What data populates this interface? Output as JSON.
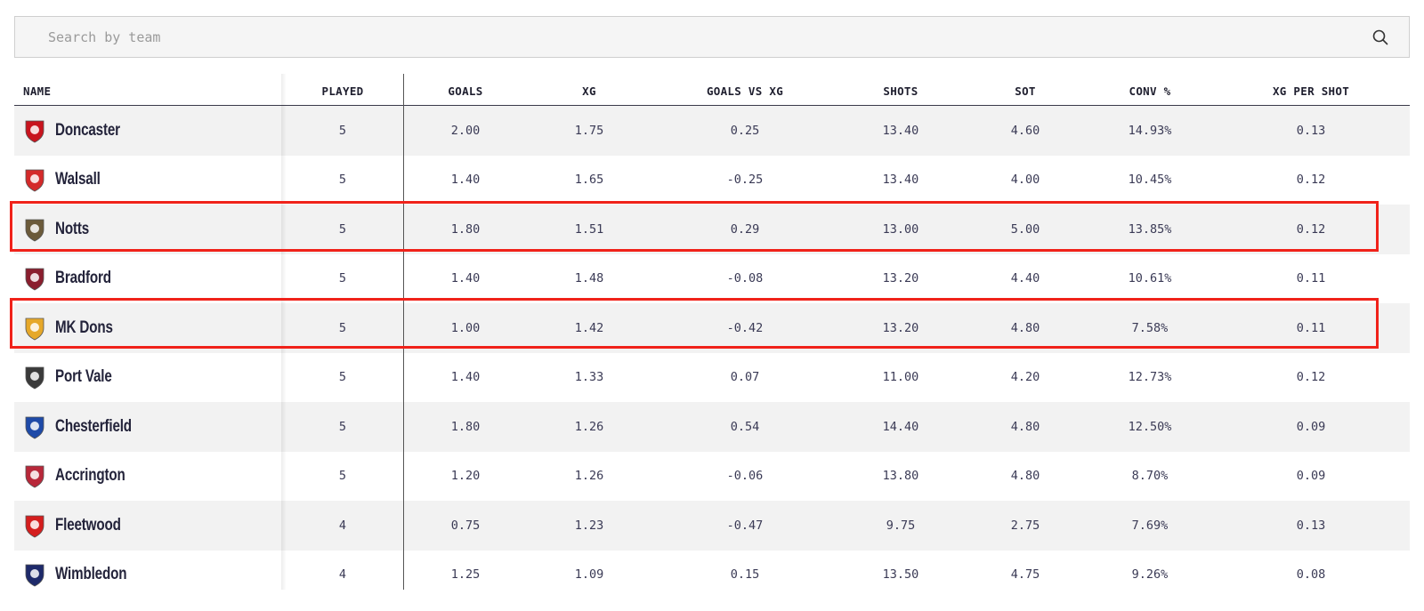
{
  "search": {
    "placeholder": "Search by team",
    "value": "",
    "icon": "search-icon"
  },
  "columns": [
    "NAME",
    "PLAYED",
    "GOALS",
    "XG",
    "GOALS VS XG",
    "SHOTS",
    "SOT",
    "CONV %",
    "XG PER SHOT"
  ],
  "rows": [
    {
      "team": "Doncaster",
      "badge_color": "#c8141e",
      "played": "5",
      "goals": "2.00",
      "xg": "1.75",
      "goals_vs_xg": "0.25",
      "shots": "13.40",
      "sot": "4.60",
      "conv": "14.93%",
      "xg_per_shot": "0.13"
    },
    {
      "team": "Walsall",
      "badge_color": "#d42a2a",
      "played": "5",
      "goals": "1.40",
      "xg": "1.65",
      "goals_vs_xg": "-0.25",
      "shots": "13.40",
      "sot": "4.00",
      "conv": "10.45%",
      "xg_per_shot": "0.12"
    },
    {
      "team": "Notts",
      "badge_color": "#6b5a3a",
      "played": "5",
      "goals": "1.80",
      "xg": "1.51",
      "goals_vs_xg": "0.29",
      "shots": "13.00",
      "sot": "5.00",
      "conv": "13.85%",
      "xg_per_shot": "0.12"
    },
    {
      "team": "Bradford",
      "badge_color": "#8a1e2e",
      "played": "5",
      "goals": "1.40",
      "xg": "1.48",
      "goals_vs_xg": "-0.08",
      "shots": "13.20",
      "sot": "4.40",
      "conv": "10.61%",
      "xg_per_shot": "0.11"
    },
    {
      "team": "MK Dons",
      "badge_color": "#e6a82a",
      "played": "5",
      "goals": "1.00",
      "xg": "1.42",
      "goals_vs_xg": "-0.42",
      "shots": "13.20",
      "sot": "4.80",
      "conv": "7.58%",
      "xg_per_shot": "0.11"
    },
    {
      "team": "Port Vale",
      "badge_color": "#3a3a3a",
      "played": "5",
      "goals": "1.40",
      "xg": "1.33",
      "goals_vs_xg": "0.07",
      "shots": "11.00",
      "sot": "4.20",
      "conv": "12.73%",
      "xg_per_shot": "0.12"
    },
    {
      "team": "Chesterfield",
      "badge_color": "#1e4aa8",
      "played": "5",
      "goals": "1.80",
      "xg": "1.26",
      "goals_vs_xg": "0.54",
      "shots": "14.40",
      "sot": "4.80",
      "conv": "12.50%",
      "xg_per_shot": "0.09"
    },
    {
      "team": "Accrington",
      "badge_color": "#b8283a",
      "played": "5",
      "goals": "1.20",
      "xg": "1.26",
      "goals_vs_xg": "-0.06",
      "shots": "13.80",
      "sot": "4.80",
      "conv": "8.70%",
      "xg_per_shot": "0.09"
    },
    {
      "team": "Fleetwood",
      "badge_color": "#d41e1e",
      "played": "4",
      "goals": "0.75",
      "xg": "1.23",
      "goals_vs_xg": "-0.47",
      "shots": "9.75",
      "sot": "2.75",
      "conv": "7.69%",
      "xg_per_shot": "0.13"
    },
    {
      "team": "Wimbledon",
      "badge_color": "#1e2a6a",
      "played": "4",
      "goals": "1.25",
      "xg": "1.09",
      "goals_vs_xg": "0.15",
      "shots": "13.50",
      "sot": "4.75",
      "conv": "9.26%",
      "xg_per_shot": "0.08"
    }
  ],
  "highlighted_teams": [
    "Notts",
    "MK Dons"
  ],
  "colors": {
    "highlight_border": "#f0221a",
    "row_alt": "#f2f2f2",
    "text": "#3a3a55"
  }
}
